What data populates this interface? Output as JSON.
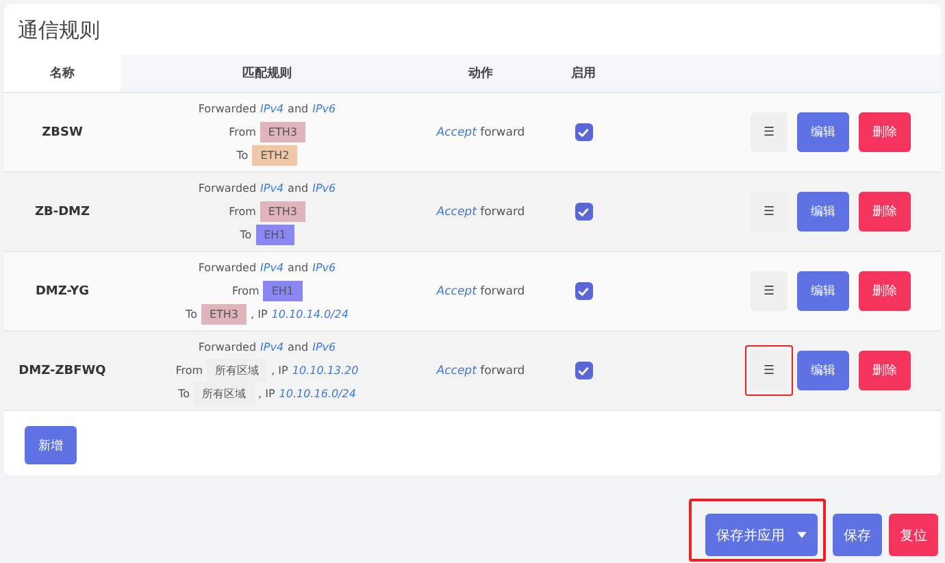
{
  "title": "通信规则",
  "columns": [
    "名称",
    "匹配规则",
    "动作",
    "启用"
  ],
  "rows": [
    {
      "name": "ZBSW",
      "match": [
        [
          {
            "kind": "text",
            "text": "Forwarded"
          },
          {
            "kind": "link",
            "text": "IPv4"
          },
          {
            "kind": "text",
            "text": "and"
          },
          {
            "kind": "link",
            "text": "IPv6"
          }
        ],
        [
          {
            "kind": "text",
            "text": "From"
          },
          {
            "kind": "zone",
            "text": "ETH3",
            "color": "#e0b4bc"
          }
        ],
        [
          {
            "kind": "text",
            "text": "To"
          },
          {
            "kind": "zone",
            "text": "ETH2",
            "color": "#f0c8a8"
          }
        ]
      ],
      "action": {
        "verb": "Accept",
        "rest": "forward"
      },
      "enabled": true,
      "move_highlighted": false,
      "move": "☰",
      "edit": "编辑",
      "delete": "删除"
    },
    {
      "name": "ZB-DMZ",
      "match": [
        [
          {
            "kind": "text",
            "text": "Forwarded"
          },
          {
            "kind": "link",
            "text": "IPv4"
          },
          {
            "kind": "text",
            "text": "and"
          },
          {
            "kind": "link",
            "text": "IPv6"
          }
        ],
        [
          {
            "kind": "text",
            "text": "From"
          },
          {
            "kind": "zone",
            "text": "ETH3",
            "color": "#e0b4bc"
          }
        ],
        [
          {
            "kind": "text",
            "text": "To"
          },
          {
            "kind": "zone",
            "text": "EH1",
            "color": "#8a86f4"
          }
        ]
      ],
      "action": {
        "verb": "Accept",
        "rest": "forward"
      },
      "enabled": true,
      "move_highlighted": false,
      "move": "☰",
      "edit": "编辑",
      "delete": "删除"
    },
    {
      "name": "DMZ-YG",
      "match": [
        [
          {
            "kind": "text",
            "text": "Forwarded"
          },
          {
            "kind": "link",
            "text": "IPv4"
          },
          {
            "kind": "text",
            "text": "and"
          },
          {
            "kind": "link",
            "text": "IPv6"
          }
        ],
        [
          {
            "kind": "text",
            "text": "From"
          },
          {
            "kind": "zone",
            "text": "EH1",
            "color": "#8a86f4"
          }
        ],
        [
          {
            "kind": "text",
            "text": "To"
          },
          {
            "kind": "zone",
            "text": "ETH3",
            "color": "#e0b4bc"
          },
          {
            "kind": "text",
            "text": ", IP"
          },
          {
            "kind": "link",
            "text": "10.10.14.0/24"
          }
        ]
      ],
      "action": {
        "verb": "Accept",
        "rest": "forward"
      },
      "enabled": true,
      "move_highlighted": false,
      "move": "☰",
      "edit": "编辑",
      "delete": "删除"
    },
    {
      "name": "DMZ-ZBFWQ",
      "match": [
        [
          {
            "kind": "text",
            "text": "Forwarded"
          },
          {
            "kind": "link",
            "text": "IPv4"
          },
          {
            "kind": "text",
            "text": "and"
          },
          {
            "kind": "link",
            "text": "IPv6"
          }
        ],
        [
          {
            "kind": "text",
            "text": "From"
          },
          {
            "kind": "zone",
            "text": "所有区域",
            "color": "#efefef"
          },
          {
            "kind": "text",
            "text": ", IP"
          },
          {
            "kind": "link",
            "text": "10.10.13.20"
          }
        ],
        [
          {
            "kind": "text",
            "text": "To"
          },
          {
            "kind": "zone",
            "text": "所有区域",
            "color": "#efefef"
          },
          {
            "kind": "text",
            "text": ", IP"
          },
          {
            "kind": "link",
            "text": "10.10.16.0/24"
          }
        ]
      ],
      "action": {
        "verb": "Accept",
        "rest": "forward"
      },
      "enabled": true,
      "move_highlighted": true,
      "move": "☰",
      "edit": "编辑",
      "delete": "删除"
    }
  ],
  "add_button": "新增",
  "footer": {
    "save_apply": "保存并应用",
    "save_apply_highlighted": true,
    "save": "保存",
    "reset": "复位"
  }
}
